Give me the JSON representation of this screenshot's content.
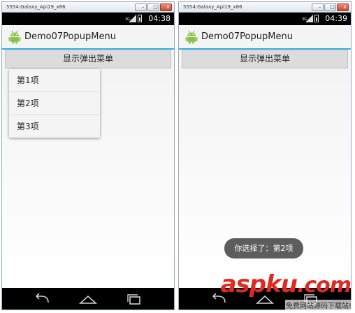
{
  "emulator": {
    "window_title": "5554:Galaxy_Api19_x86"
  },
  "screens": [
    {
      "clock": "04:38",
      "signal_label": "3G"
    },
    {
      "clock": "04:39",
      "signal_label": "3G"
    }
  ],
  "app": {
    "title": "Demo07PopupMenu"
  },
  "main": {
    "show_button_label": "显示弹出菜单"
  },
  "popup_menu": {
    "items": [
      "第1项",
      "第2项",
      "第3项"
    ]
  },
  "toast": {
    "text": "你选择了：第2项"
  },
  "navbar": {
    "icons": [
      "back-icon",
      "home-icon",
      "recent-apps-icon"
    ]
  },
  "watermark": {
    "text": "aspku",
    "dot": ".com",
    "subtitle": "免费网站源码下载站!"
  },
  "colors": {
    "accent": "#33b5e5",
    "statusbar": "#000000",
    "watermark": "#e02a1f"
  }
}
